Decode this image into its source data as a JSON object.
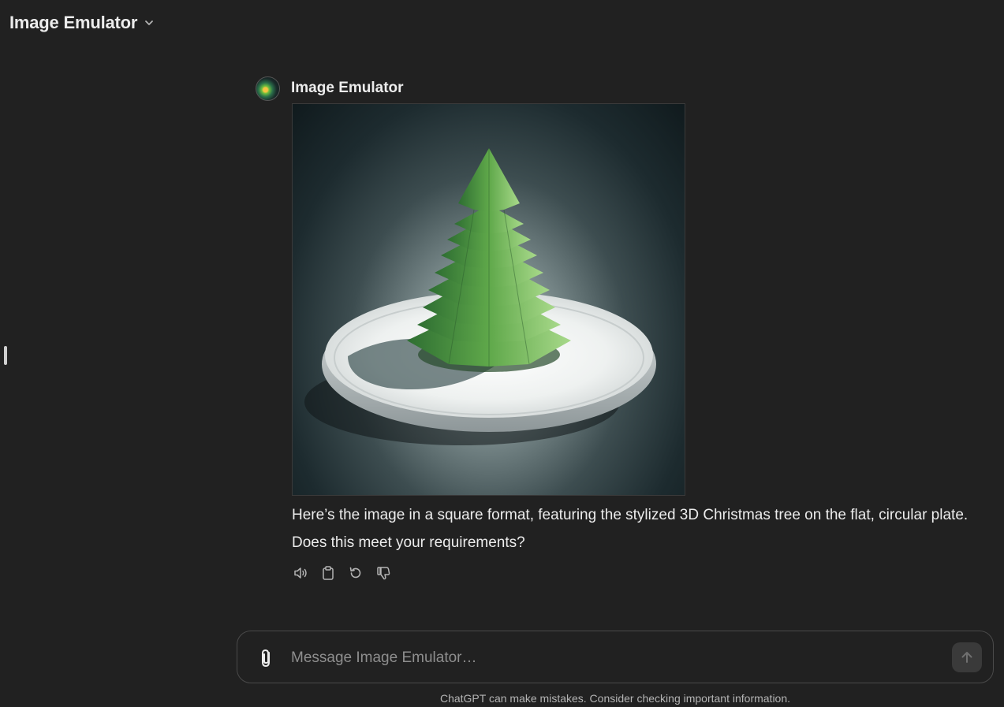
{
  "header": {
    "title": "Image Emulator",
    "dropdown_icon": "chevron-down-icon"
  },
  "message": {
    "sender": "Image Emulator",
    "avatar_icon": "gpt-avatar",
    "image_alt": "Stylized low-poly 3D Christmas tree on a flat white circular plate",
    "text": "Here’s the image in a square format, featuring the stylized 3D Christmas tree on the flat, circular plate. Does this meet your requirements?",
    "actions": [
      {
        "name": "read-aloud",
        "icon": "speaker-icon"
      },
      {
        "name": "copy",
        "icon": "clipboard-icon"
      },
      {
        "name": "regenerate",
        "icon": "refresh-icon"
      },
      {
        "name": "bad-response",
        "icon": "thumbs-down-icon"
      }
    ]
  },
  "composer": {
    "placeholder": "Message Image Emulator…",
    "value": "",
    "attach_icon": "paperclip-icon",
    "send_icon": "arrow-up-icon"
  },
  "footer": {
    "disclaimer": "ChatGPT can make mistakes. Consider checking important information."
  },
  "colors": {
    "background": "#212121",
    "text": "#ececec",
    "muted": "#b4b4b4",
    "tree_green": "#5fa84a"
  }
}
